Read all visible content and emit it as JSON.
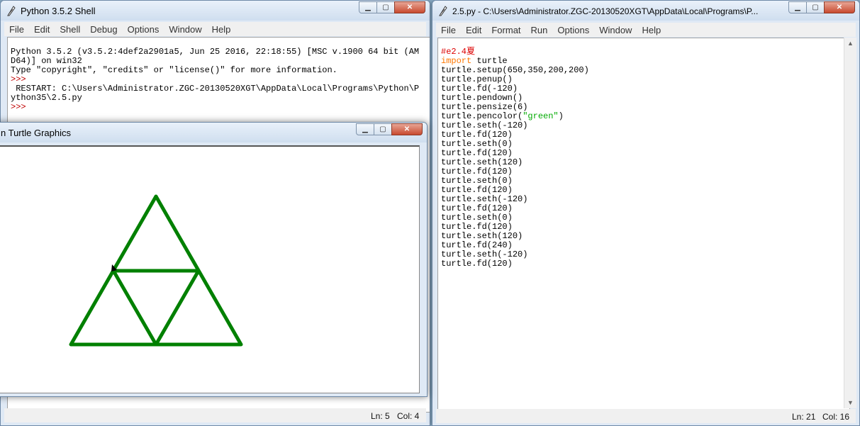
{
  "shell": {
    "title": "Python 3.5.2 Shell",
    "menu": [
      "File",
      "Edit",
      "Shell",
      "Debug",
      "Options",
      "Window",
      "Help"
    ],
    "lines": [
      "Python 3.5.2 (v3.5.2:4def2a2901a5, Jun 25 2016, 22:18:55) [MSC v.1900 64 bit (AM",
      "D64)] on win32",
      "Type \"copyright\", \"credits\" or \"license()\" for more information."
    ],
    "prompt": ">>>",
    "restart_lines": [
      " RESTART: C:\\Users\\Administrator.ZGC-20130520XGT\\AppData\\Local\\Programs\\Python\\P",
      "ython35\\2.5.py"
    ],
    "status_ln": "Ln: 5",
    "status_col": "Col: 4"
  },
  "editor": {
    "title": "2.5.py - C:\\Users\\Administrator.ZGC-20130520XGT\\AppData\\Local\\Programs\\P...",
    "menu": [
      "File",
      "Edit",
      "Format",
      "Run",
      "Options",
      "Window",
      "Help"
    ],
    "comment": "#e2.4夏",
    "import_kw": "import",
    "import_mod": " turtle",
    "code_lines": [
      "turtle.setup(650,350,200,200)",
      "turtle.penup()",
      "turtle.fd(-120)",
      "turtle.pendown()",
      "turtle.pensize(6)"
    ],
    "pencolor_pre": "turtle.pencolor(",
    "pencolor_str": "\"green\"",
    "pencolor_post": ")",
    "code_lines_2": [
      "turtle.seth(-120)",
      "turtle.fd(120)",
      "turtle.seth(0)",
      "turtle.fd(120)",
      "turtle.seth(120)",
      "turtle.fd(120)",
      "turtle.seth(0)",
      "turtle.fd(120)",
      "turtle.seth(-120)",
      "turtle.fd(120)",
      "turtle.seth(0)",
      "turtle.fd(120)",
      "turtle.seth(120)",
      "turtle.fd(240)",
      "turtle.seth(-120)",
      "turtle.fd(120)"
    ],
    "status_ln": "Ln: 21",
    "status_col": "Col: 16"
  },
  "turtle": {
    "title": "n Turtle Graphics",
    "pen_color": "#008000"
  },
  "colors": {
    "keyword": "#ff7700",
    "comment": "#dd0000",
    "string": "#00aa00",
    "prompt": "#c00000"
  }
}
